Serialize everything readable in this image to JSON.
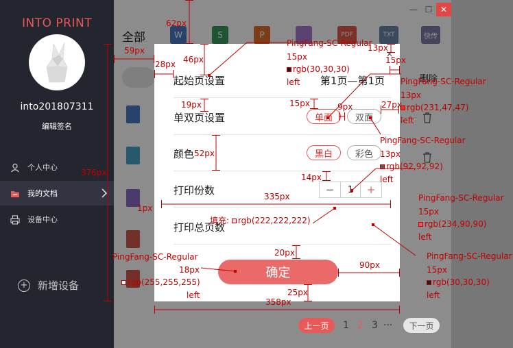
{
  "app": {
    "brand": "INTO PRINT",
    "username": "into201807311",
    "edit_signature": "编辑签名"
  },
  "sidebar": {
    "items": [
      {
        "label": "个人中心",
        "icon": "user-icon",
        "active": false
      },
      {
        "label": "我的文档",
        "icon": "folder-icon",
        "active": true
      },
      {
        "label": "设备中心",
        "icon": "printer-icon",
        "active": false
      }
    ],
    "add_device": "新增设备"
  },
  "main": {
    "title": "全部",
    "toolbar_icons": [
      {
        "name": "word-icon",
        "label": "W",
        "color": "#4a79c4"
      },
      {
        "name": "sheet-icon",
        "label": "S",
        "color": "#3a9a5c"
      },
      {
        "name": "ppt-icon",
        "label": "P",
        "color": "#e0702a"
      },
      {
        "name": "image-icon",
        "label": "",
        "color": "#a57bd0"
      },
      {
        "name": "pdf-icon",
        "label": "PDF",
        "color": "#e05a4a"
      },
      {
        "name": "txt-icon",
        "label": "TXT",
        "color": "#6b88a8"
      },
      {
        "name": "fax-icon",
        "label": "快传",
        "color": "#7c7ca8"
      }
    ],
    "delete_label": "删除",
    "pagination": {
      "prev": "上一页",
      "pages": [
        "1",
        "2",
        "3",
        "···"
      ],
      "current": "2",
      "next": "下一页"
    }
  },
  "dialog": {
    "start_page": {
      "label": "起始页设置",
      "value": "第1页—第1页"
    },
    "duplex": {
      "label": "单双页设置",
      "options": [
        "单面",
        "双面"
      ],
      "selected": "单面"
    },
    "color": {
      "label": "颜色",
      "options": [
        "黑白",
        "彩色"
      ],
      "selected": "黑白"
    },
    "copies": {
      "label": "打印份数",
      "minus": "−",
      "value": "1",
      "plus": "+"
    },
    "total_copies": {
      "label": "打印总页数"
    },
    "confirm": "确定"
  },
  "annotations": {
    "dims": {
      "d62": "62px",
      "d46": "46px",
      "d59": "59px",
      "d28": "28px",
      "d19": "19px",
      "d52": "52px",
      "d376": "376px",
      "d1": "1px",
      "d335": "335px",
      "d20": "20px",
      "d25": "25px",
      "d358": "358px",
      "d90": "90px",
      "d13": "13px",
      "d15a": "15px",
      "d15b": "15px",
      "d9": "9px",
      "d27": "27px",
      "d14": "14px"
    },
    "fonts": {
      "f1": {
        "family": "PingFang-SC-Regular",
        "size": "15px",
        "color": "rgb(30,30,30)",
        "align": "left",
        "swatch": "#1e1e1e"
      },
      "f2": {
        "family": "PingFang-SC-Regular",
        "size": "13px",
        "color": "rgb(231,47,47)",
        "align": "left",
        "swatch": "#e72f2f"
      },
      "f3": {
        "family": "PingFang-SC-Regular",
        "size": "13px",
        "color": "rgb(92,92,92)",
        "align": "left",
        "swatch": "#5c5c5c"
      },
      "f4": {
        "family": "PingFang-SC-Regular",
        "size": "15px",
        "color": "rgb(234,90,90)",
        "align": "left",
        "swatch": "#ea5a5a"
      },
      "f5": {
        "family": "PingFang-SC-Regular",
        "size": "15px",
        "color": "rgb(30,30,30)",
        "align": "left",
        "swatch": "#1e1e1e"
      },
      "f6": {
        "family": "PingFang-SC-Regular",
        "size": "18px",
        "color": "rgb(255,255,255)",
        "align": "left",
        "swatch": "#ffffff"
      }
    },
    "fill": {
      "label": "填充:",
      "color": "rgb(222,222,222)",
      "swatch": "#dedede"
    }
  }
}
